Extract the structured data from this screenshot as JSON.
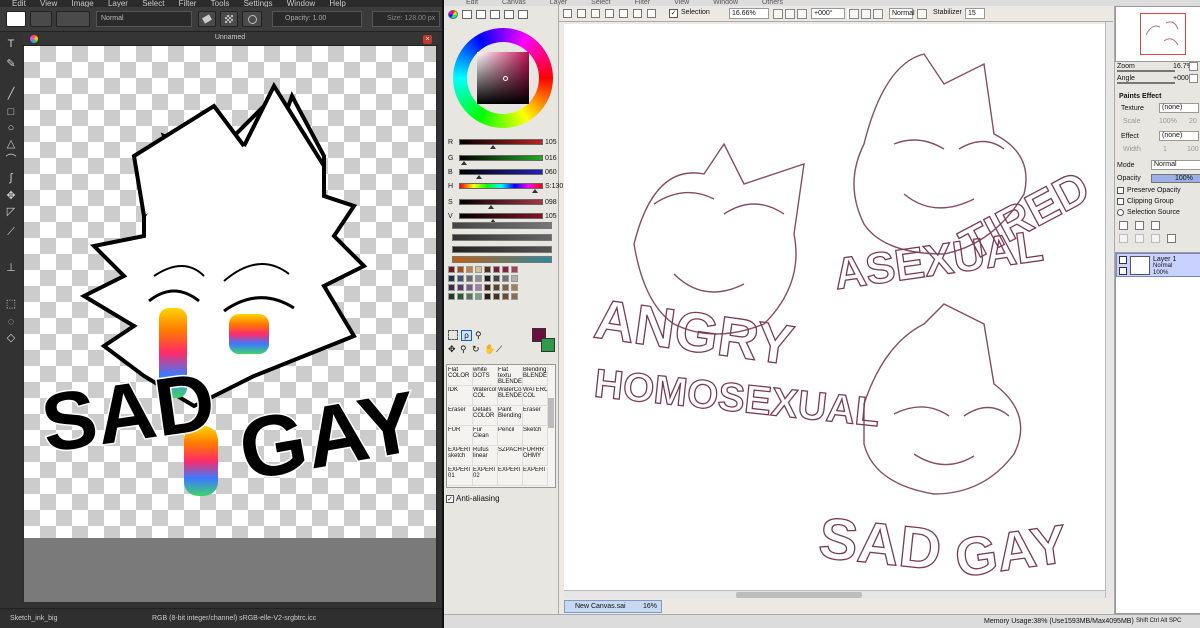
{
  "left_app": {
    "menu": [
      "Edit",
      "View",
      "Image",
      "Layer",
      "Select",
      "Filter",
      "Tools",
      "Settings",
      "Window",
      "Help"
    ],
    "toolbar": {
      "blend_mode": "Normal",
      "opacity_label": "Opacity: 1.00",
      "size_label": "Size: 128.00 px"
    },
    "doc_tab_title": "Unnamed",
    "statusbar": {
      "brush": "Sketch_ink_big",
      "color_info": "RGB (8-bit integer/channel)  sRGB-elle-V2-srgbtrc.icc"
    },
    "artwork_words": [
      "SAD",
      "GAY"
    ]
  },
  "right_app": {
    "menu": [
      "Edit",
      "Canvas",
      "Layer",
      "Select",
      "Filter",
      "View",
      "Window",
      "Others"
    ],
    "top_toolbar": {
      "selection_label": "Selection",
      "zoom": "16.66%",
      "angle": "+000°",
      "mode": "Normal",
      "stabilizer_label": "Stabilizer",
      "stabilizer_value": "15"
    },
    "color_sliders": [
      {
        "label": "R",
        "value": "105",
        "color": "#b22"
      },
      {
        "label": "G",
        "value": "016",
        "color": "#2a2"
      },
      {
        "label": "B",
        "value": "060",
        "color": "#22b"
      },
      {
        "label": "H",
        "value": "S:130",
        "color": "#e0a"
      },
      {
        "label": "S",
        "value": "098",
        "color": "#a34"
      },
      {
        "label": "V",
        "value": "105",
        "color": "#812"
      }
    ],
    "brushes": [
      [
        "Flat COLOR",
        "white DOTS",
        "Flat textu BLENDE",
        "Blending BLENDE"
      ],
      [
        "IDK",
        "Watercol COL",
        "WaterCo BLENDE",
        "WATERC COL"
      ],
      [
        "Eraser",
        "Details COLOR",
        "Paint Blending",
        "Eraser"
      ],
      [
        "FUR",
        "Fur Clean",
        "Pencil",
        "Sketch"
      ],
      [
        "EXPERI sketch",
        "Rufus linear",
        "SZPACH",
        "FURRR OHMY"
      ],
      [
        "EXPERI 01",
        "EXPERI 02",
        "EXPERI",
        "EXPERI"
      ]
    ],
    "antialias_label": "Anti-aliasing",
    "navigator": {
      "zoom_label": "Zoom",
      "zoom_value": "16.7%",
      "angle_label": "Angle",
      "angle_value": "+0008"
    },
    "paints_effect": {
      "title": "Paints Effect",
      "texture_label": "Texture",
      "texture_value": "(none)",
      "scale_label": "Scale",
      "scale_value": "100%",
      "scale_num": "20",
      "effect_label": "Effect",
      "effect_value": "(none)",
      "width_label": "Width",
      "width_value": "1",
      "width_num": "100"
    },
    "layer_props": {
      "mode_label": "Mode",
      "mode_value": "Normal",
      "opacity_label": "Opacity",
      "opacity_value": "100%",
      "preserve_opacity": "Preserve Opacity",
      "clipping_group": "Clipping Group",
      "selection_source": "Selection Source"
    },
    "layer": {
      "name": "Layer 1",
      "mode": "Normal",
      "opacity": "100%"
    },
    "file_tab": {
      "name": "New Canvas.sai",
      "zoom": "16%"
    },
    "statusbar": {
      "memory": "Memory Usage:38% (Use1593MB/Max4095MB)",
      "keys": "Shift Ctrl Alt SPC"
    },
    "sketch_words": [
      "ANGRY",
      "HOMOSEXUAL",
      "TIRED",
      "ASEXUAL",
      "SAD",
      "GAY"
    ]
  }
}
